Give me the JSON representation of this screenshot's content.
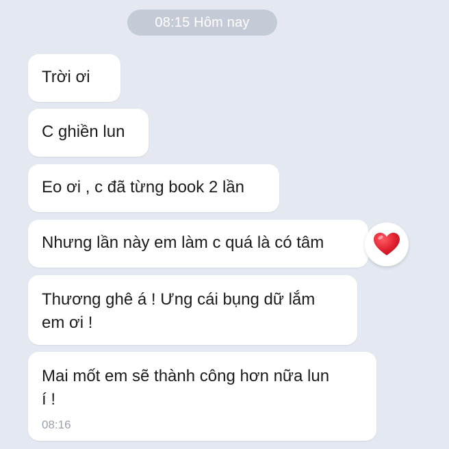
{
  "date_separator": "08:15 Hôm nay",
  "messages": [
    {
      "text": "Trời ơi"
    },
    {
      "text": "C ghiền lun"
    },
    {
      "text": "Eo ơi , c đã từng book 2 lần"
    },
    {
      "text": "Nhưng lần này em làm c quá là có tâm",
      "reaction": "heart-icon"
    },
    {
      "text": "Thương ghê á ! Ưng cái bụng dữ lắm\nem ơi !"
    },
    {
      "text": "Mai mốt em sẽ thành công hơn nữa lun\ní !",
      "time": "08:16"
    }
  ],
  "colors": {
    "background": "#e3e8f1",
    "bubble": "#ffffff",
    "pill": "#c5cbd6",
    "heart": "#e0202f"
  }
}
